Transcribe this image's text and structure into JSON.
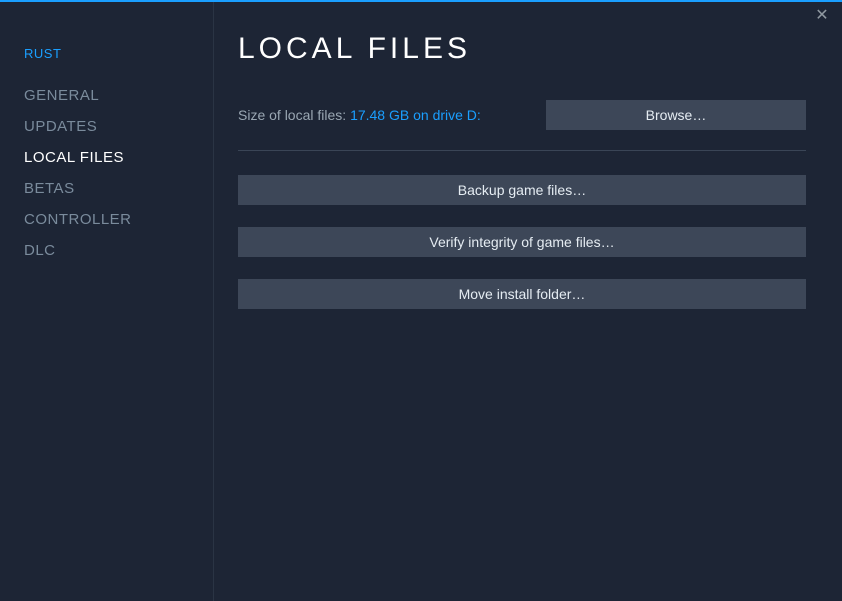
{
  "window": {
    "close_glyph": "✕"
  },
  "sidebar": {
    "title": "RUST",
    "items": [
      {
        "label": "GENERAL",
        "active": false
      },
      {
        "label": "UPDATES",
        "active": false
      },
      {
        "label": "LOCAL FILES",
        "active": true
      },
      {
        "label": "BETAS",
        "active": false
      },
      {
        "label": "CONTROLLER",
        "active": false
      },
      {
        "label": "DLC",
        "active": false
      }
    ]
  },
  "main": {
    "title": "LOCAL FILES",
    "size_label": "Size of local files: ",
    "size_value": "17.48 GB on drive D:",
    "browse_label": "Browse…",
    "backup_label": "Backup game files…",
    "verify_label": "Verify integrity of game files…",
    "move_label": "Move install folder…"
  }
}
